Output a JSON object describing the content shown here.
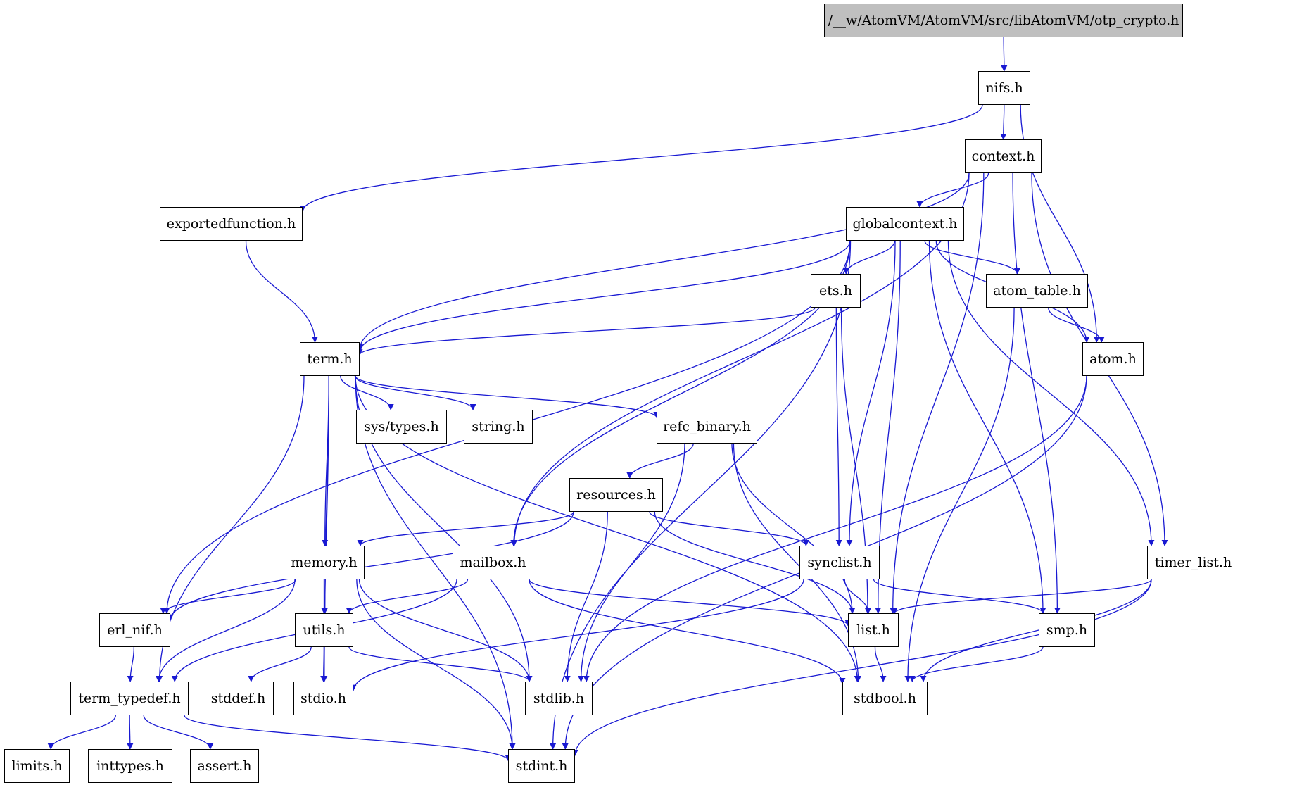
{
  "diagram": {
    "type": "include-dependency-graph",
    "root": "/__w/AtomVM/AtomVM/src/libAtomVM/otp_crypto.h",
    "colors": {
      "edge": "#1919d2",
      "root_fill": "#bfbfbf",
      "node_fill": "#ffffff",
      "border": "#000000"
    },
    "nodes": [
      {
        "id": "root",
        "label": "/__w/AtomVM/AtomVM/src/libAtomVM/otp_crypto.h",
        "root": true
      },
      {
        "id": "nifs",
        "label": "nifs.h"
      },
      {
        "id": "context",
        "label": "context.h"
      },
      {
        "id": "exportedfunction",
        "label": "exportedfunction.h"
      },
      {
        "id": "globalcontext",
        "label": "globalcontext.h"
      },
      {
        "id": "ets",
        "label": "ets.h"
      },
      {
        "id": "atom_table",
        "label": "atom_table.h"
      },
      {
        "id": "atom",
        "label": "atom.h"
      },
      {
        "id": "term",
        "label": "term.h"
      },
      {
        "id": "refc_binary",
        "label": "refc_binary.h"
      },
      {
        "id": "sys_types",
        "label": "sys/types.h"
      },
      {
        "id": "string",
        "label": "string.h"
      },
      {
        "id": "resources",
        "label": "resources.h"
      },
      {
        "id": "memory",
        "label": "memory.h"
      },
      {
        "id": "mailbox",
        "label": "mailbox.h"
      },
      {
        "id": "synclist",
        "label": "synclist.h"
      },
      {
        "id": "timer_list",
        "label": "timer_list.h"
      },
      {
        "id": "erl_nif",
        "label": "erl_nif.h"
      },
      {
        "id": "utils",
        "label": "utils.h"
      },
      {
        "id": "list",
        "label": "list.h"
      },
      {
        "id": "smp",
        "label": "smp.h"
      },
      {
        "id": "term_typedef",
        "label": "term_typedef.h"
      },
      {
        "id": "stddef",
        "label": "stddef.h"
      },
      {
        "id": "stdio",
        "label": "stdio.h"
      },
      {
        "id": "stdlib",
        "label": "stdlib.h"
      },
      {
        "id": "stdbool",
        "label": "stdbool.h"
      },
      {
        "id": "limits",
        "label": "limits.h"
      },
      {
        "id": "inttypes",
        "label": "inttypes.h"
      },
      {
        "id": "assert",
        "label": "assert.h"
      },
      {
        "id": "stdint",
        "label": "stdint.h"
      }
    ],
    "edges": [
      [
        "root",
        "nifs"
      ],
      [
        "nifs",
        "context"
      ],
      [
        "nifs",
        "exportedfunction"
      ],
      [
        "nifs",
        "atom"
      ],
      [
        "context",
        "globalcontext"
      ],
      [
        "context",
        "term"
      ],
      [
        "context",
        "mailbox"
      ],
      [
        "context",
        "list"
      ],
      [
        "context",
        "smp"
      ],
      [
        "context",
        "timer_list"
      ],
      [
        "exportedfunction",
        "term"
      ],
      [
        "globalcontext",
        "ets"
      ],
      [
        "globalcontext",
        "atom_table"
      ],
      [
        "globalcontext",
        "atom"
      ],
      [
        "globalcontext",
        "term"
      ],
      [
        "globalcontext",
        "erl_nif"
      ],
      [
        "globalcontext",
        "mailbox"
      ],
      [
        "globalcontext",
        "stdint"
      ],
      [
        "globalcontext",
        "synclist"
      ],
      [
        "globalcontext",
        "list"
      ],
      [
        "globalcontext",
        "smp"
      ],
      [
        "globalcontext",
        "timer_list"
      ],
      [
        "ets",
        "term"
      ],
      [
        "ets",
        "synclist"
      ],
      [
        "ets",
        "list"
      ],
      [
        "atom_table",
        "atom"
      ],
      [
        "atom_table",
        "stdbool"
      ],
      [
        "atom",
        "stdlib"
      ],
      [
        "atom",
        "stdint"
      ],
      [
        "term",
        "sys_types"
      ],
      [
        "term",
        "string"
      ],
      [
        "term",
        "refc_binary"
      ],
      [
        "term",
        "memory"
      ],
      [
        "term",
        "utils"
      ],
      [
        "term",
        "term_typedef"
      ],
      [
        "term",
        "stdio"
      ],
      [
        "term",
        "stdlib"
      ],
      [
        "term",
        "stdint"
      ],
      [
        "term",
        "stdbool"
      ],
      [
        "refc_binary",
        "resources"
      ],
      [
        "refc_binary",
        "stdlib"
      ],
      [
        "refc_binary",
        "stdbool"
      ],
      [
        "refc_binary",
        "list"
      ],
      [
        "resources",
        "memory"
      ],
      [
        "resources",
        "erl_nif"
      ],
      [
        "resources",
        "synclist"
      ],
      [
        "resources",
        "list"
      ],
      [
        "resources",
        "stdlib"
      ],
      [
        "memory",
        "erl_nif"
      ],
      [
        "memory",
        "utils"
      ],
      [
        "memory",
        "term_typedef"
      ],
      [
        "memory",
        "stdlib"
      ],
      [
        "memory",
        "stdint"
      ],
      [
        "mailbox",
        "utils"
      ],
      [
        "mailbox",
        "term_typedef"
      ],
      [
        "mailbox",
        "list"
      ],
      [
        "mailbox",
        "stdbool"
      ],
      [
        "synclist",
        "list"
      ],
      [
        "synclist",
        "smp"
      ],
      [
        "synclist",
        "stdio"
      ],
      [
        "timer_list",
        "list"
      ],
      [
        "timer_list",
        "stdbool"
      ],
      [
        "timer_list",
        "stdint"
      ],
      [
        "erl_nif",
        "term_typedef"
      ],
      [
        "utils",
        "stddef"
      ],
      [
        "utils",
        "stdio"
      ],
      [
        "utils",
        "stdlib"
      ],
      [
        "list",
        "stdbool"
      ],
      [
        "smp",
        "stdbool"
      ],
      [
        "term_typedef",
        "limits"
      ],
      [
        "term_typedef",
        "inttypes"
      ],
      [
        "term_typedef",
        "assert"
      ],
      [
        "term_typedef",
        "stdint"
      ]
    ]
  }
}
